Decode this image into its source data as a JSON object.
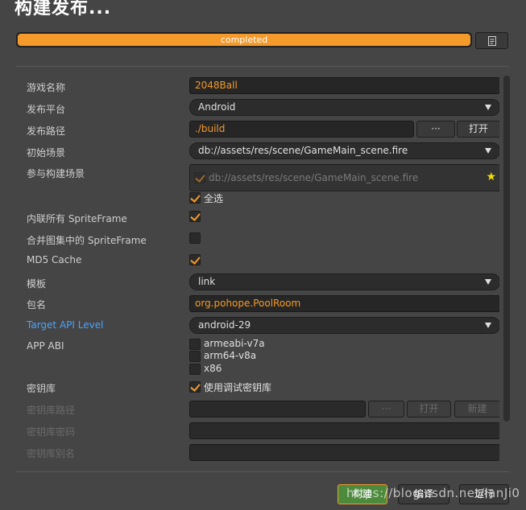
{
  "window": {
    "title": "构建发布..."
  },
  "progress": {
    "label": "completed",
    "value": 1.0,
    "color": "#f39a2b"
  },
  "doc_button": {
    "icon": "document-icon"
  },
  "form": {
    "game_name": {
      "label": "游戏名称",
      "value": "2048Ball"
    },
    "platform": {
      "label": "发布平台",
      "value": "Android"
    },
    "build_path": {
      "label": "发布路径",
      "value": "./build",
      "browse": "···",
      "open": "打开"
    },
    "start_scene": {
      "label": "初始场景",
      "value": "db://assets/res/scene/GameMain_scene.fire"
    },
    "included_scenes": {
      "label": "参与构建场景",
      "items": [
        "db://assets/res/scene/GameMain_scene.fire"
      ],
      "select_all": "全选"
    },
    "inline_spriteframe": {
      "label": "内联所有 SpriteFrame",
      "checked": true
    },
    "merge_spriteframe": {
      "label": "合并图集中的 SpriteFrame",
      "checked": false
    },
    "md5_cache": {
      "label": "MD5 Cache",
      "checked": true
    },
    "template": {
      "label": "模板",
      "value": "link"
    },
    "package_name": {
      "label": "包名",
      "value": "org.pohope.PoolRoom"
    },
    "target_api": {
      "label": "Target API Level",
      "value": "android-29"
    },
    "app_abi": {
      "label": "APP ABI",
      "options": [
        {
          "name": "armeabi-v7a",
          "checked": false
        },
        {
          "name": "arm64-v8a",
          "checked": false
        },
        {
          "name": "x86",
          "checked": false
        }
      ]
    },
    "keystore": {
      "label": "密钥库",
      "option": "使用调试密钥库",
      "checked": true
    },
    "keystore_path": {
      "label": "密钥库路径",
      "browse": "···",
      "open": "打开",
      "new": "新建"
    },
    "keystore_password": {
      "label": "密钥库密码"
    },
    "keystore_alias": {
      "label": "密钥库别名"
    }
  },
  "footer": {
    "build": "构建",
    "compile": "编译",
    "run": "运行",
    "watermark": "https://blog.csdn.net/ianJi0"
  },
  "colors": {
    "accent": "#f39a2b",
    "link_blue": "#4aa3ff",
    "build_green": "#4c8a3c",
    "star": "#f2e100"
  }
}
